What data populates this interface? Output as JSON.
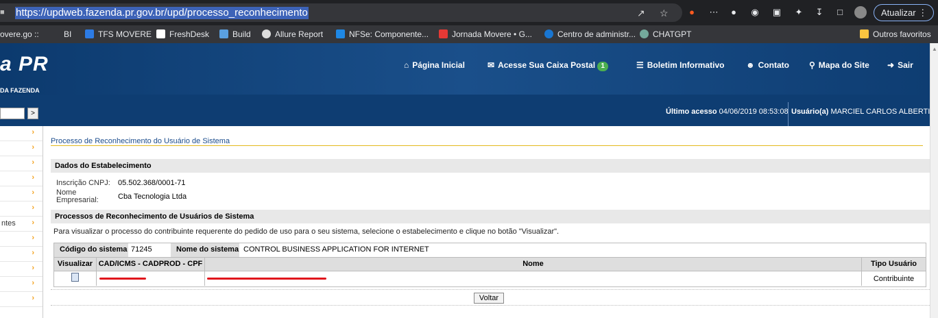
{
  "browser": {
    "url": "https://updweb.fazenda.pr.gov.br/upd/processo_reconhecimento",
    "update_label": "Atualizar",
    "bookmarks": [
      "overe.go ::",
      "BI",
      "TFS MOVERE",
      "FreshDesk",
      "Build",
      "Allure Report",
      "NFSe: Componente...",
      "Jornada Movere • G...",
      "Centro de administr...",
      "CHATGPT"
    ],
    "other_bookmarks": "Outros favoritos"
  },
  "site": {
    "logo": "a PR",
    "logo_sub": "DA FAZENDA",
    "nav": {
      "home": "Página Inicial",
      "mailbox": "Acesse Sua Caixa Postal",
      "mailbox_count": "1",
      "bulletin": "Boletim Informativo",
      "contact": "Contato",
      "sitemap": "Mapa do Site",
      "exit": "Sair"
    },
    "search_go": ">",
    "last_access_label": "Último acesso",
    "last_access_value": "04/06/2019 08:53:08",
    "user_label": "Usuário(a)",
    "user_value": "MARCIEL CARLOS ALBERTI"
  },
  "sidebar": {
    "items": [
      "",
      "",
      "",
      "",
      "",
      "",
      "ntes",
      "",
      "",
      "",
      "",
      ""
    ]
  },
  "main": {
    "title": "Processo de Reconhecimento do Usuário de Sistema",
    "section1": "Dados do Estabelecimento",
    "cnpj_label": "Inscrição CNPJ:",
    "cnpj_value": "05.502.368/0001-71",
    "name_label_1": "Nome",
    "name_label_2": "Empresarial:",
    "name_value": "Cba Tecnologia Ltda",
    "section2": "Processos de Reconhecimento de Usuários de Sistema",
    "info": "Para visualizar o processo do contribuinte requerente do pedido de uso para o seu sistema, selecione o estabelecimento e clique no botão \"Visualizar\".",
    "sys_code_label": "Código do sistema",
    "sys_code_value": "71245",
    "sys_name_label": "Nome do sistema",
    "sys_name_value": "CONTROL BUSINESS APPLICATION FOR INTERNET",
    "columns": [
      "Visualizar",
      "CAD/ICMS - CADPROD - CPF",
      "Nome",
      "Tipo Usuário"
    ],
    "row": {
      "tipo": "Contribuinte"
    },
    "back_button": "Voltar"
  },
  "colors": {
    "header_blue": "#0e3d72",
    "accent_gold": "#e4b81c",
    "chevron_orange": "#f4a21d"
  }
}
